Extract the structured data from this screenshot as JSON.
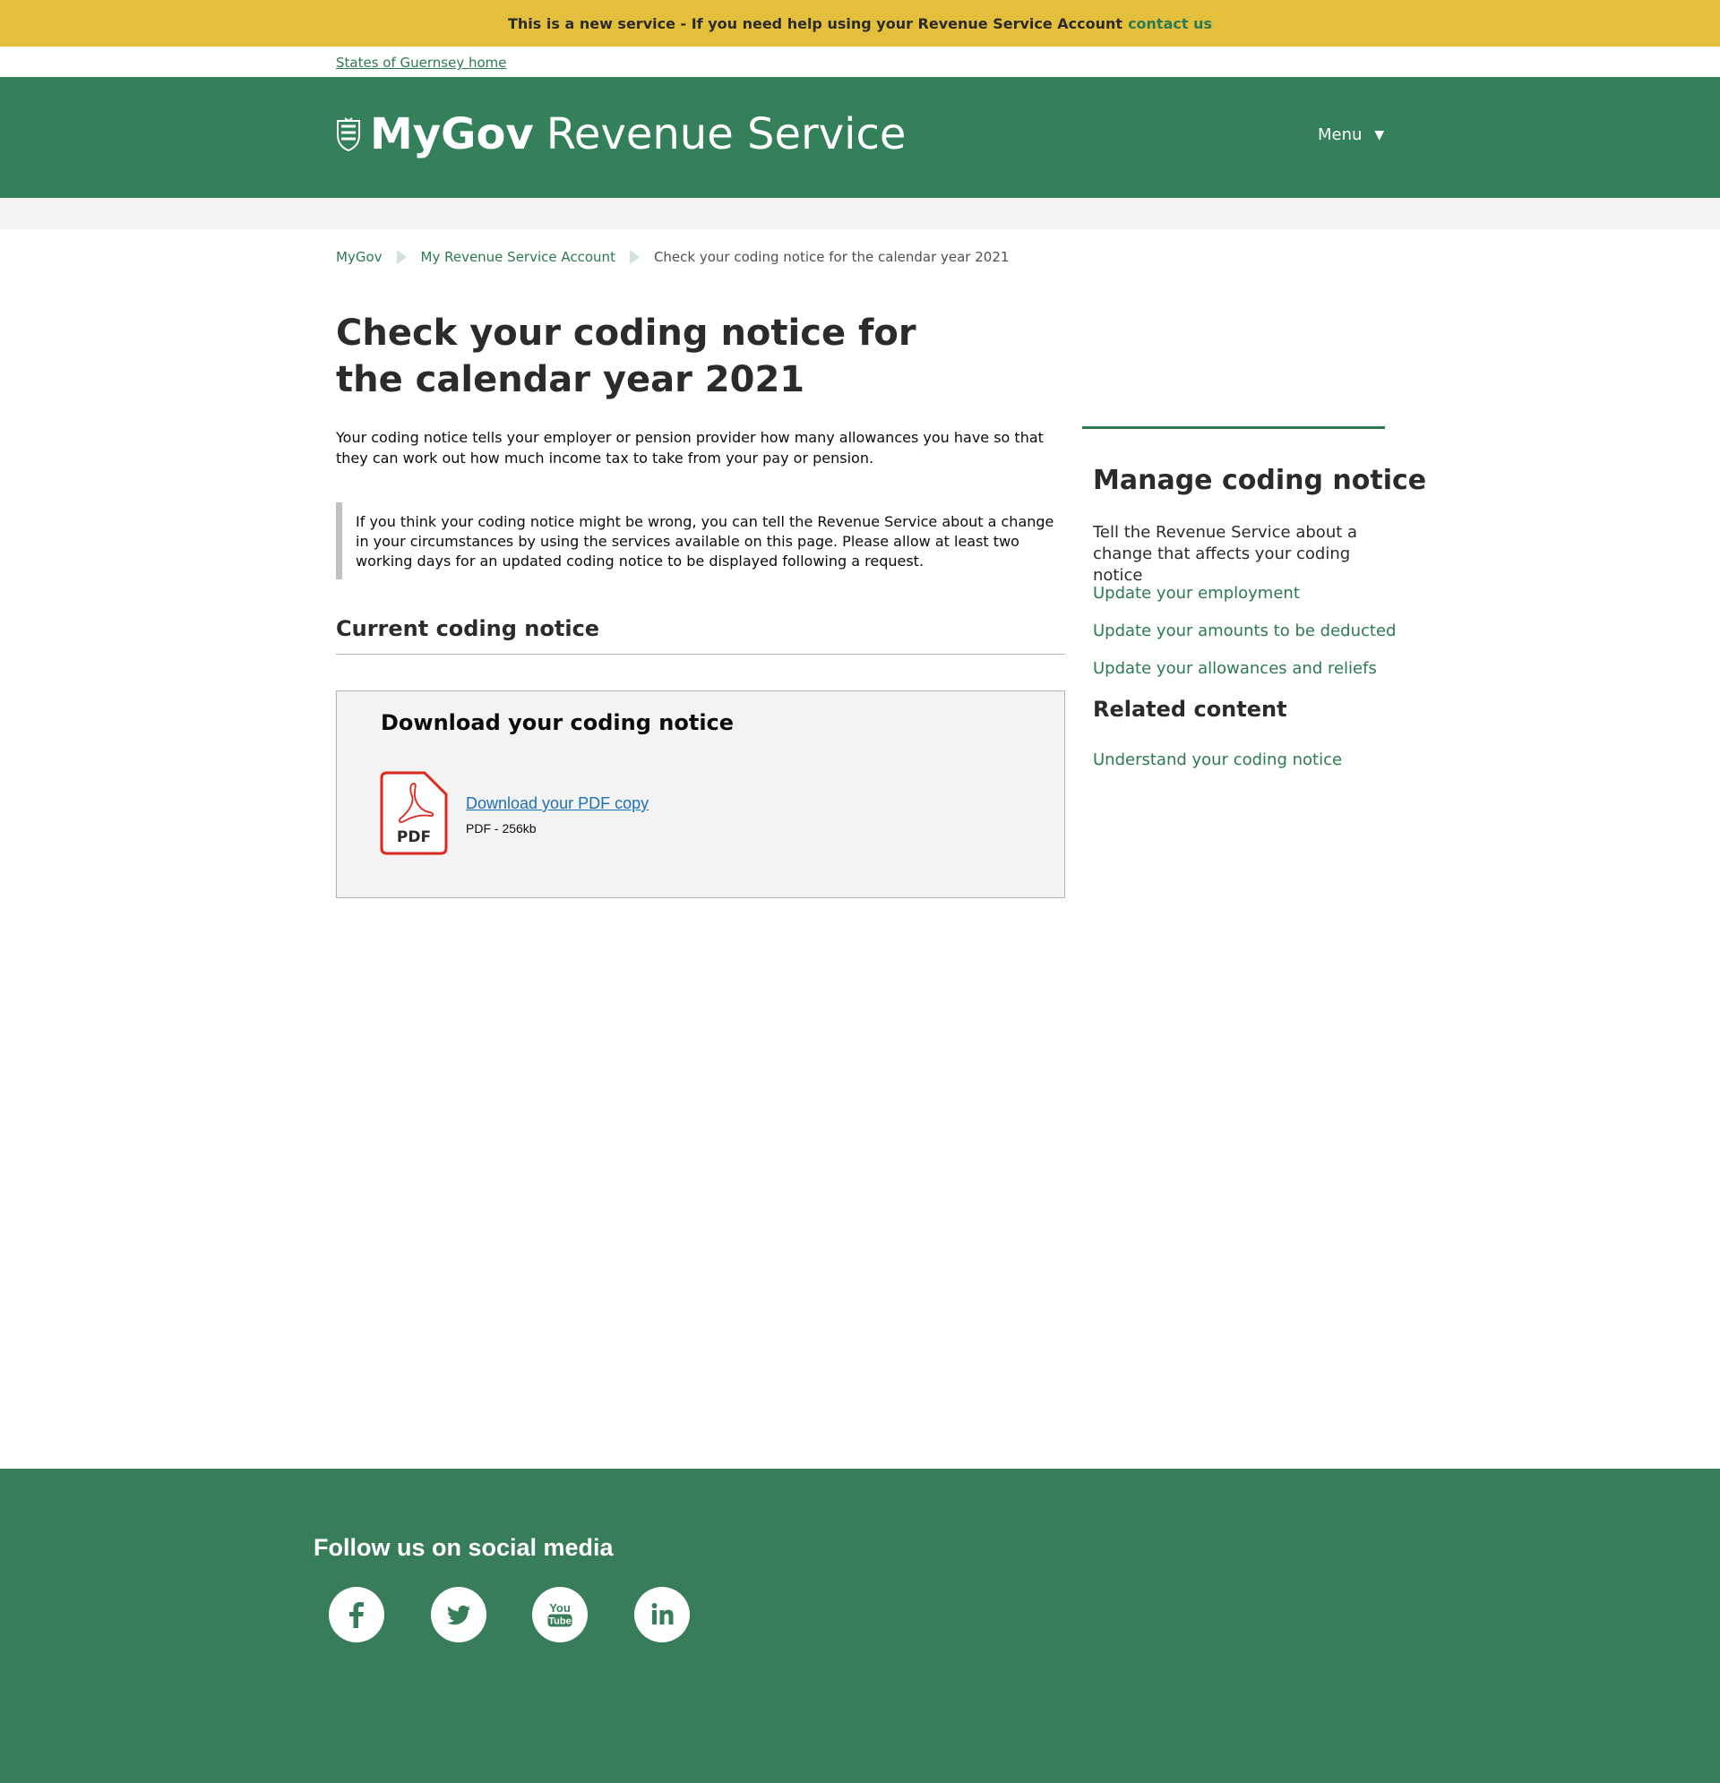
{
  "banner": {
    "text": "This is a new service - If you need help using your Revenue Service Account",
    "link": "contact us"
  },
  "top_link": "States of Guernsey home",
  "header": {
    "brand_bold": "MyGov",
    "brand_light": "Revenue Service",
    "menu_label": "Menu",
    "menu_caret": "▼",
    "crest_icon": "guernsey-crest-icon"
  },
  "breadcrumb": {
    "items": [
      "MyGov",
      "My Revenue Service Account"
    ],
    "current": "Check your coding notice for the calendar year 2021"
  },
  "main": {
    "title": "Check your coding notice for the calendar year 2021",
    "intro": "Your coding notice tells your employer or pension provider how many allowances you have so that they can work out how much income tax to take from your pay or pension.",
    "inset": "If you think your coding notice might be wrong, you can tell the Revenue Service about a change in your circumstances by using the services available on this page. Please allow at least two working days for an updated coding notice to be displayed following a request.",
    "section_title": "Current coding notice",
    "download": {
      "heading": "Download your coding notice",
      "icon_label": "PDF",
      "link": "Download your PDF copy",
      "meta": "PDF - 256kb"
    }
  },
  "sidebar": {
    "heading": "Manage coding notice",
    "description": "Tell the Revenue Service about a change that affects your coding notice",
    "links": [
      "Update your employment",
      "Update your amounts to be deducted",
      "Update your allowances and reliefs"
    ],
    "related_heading": "Related content",
    "related_links": [
      "Understand your coding notice"
    ]
  },
  "footer": {
    "heading": "Follow us on social media",
    "social_icons": [
      "facebook-icon",
      "twitter-icon",
      "youtube-icon",
      "linkedin-icon"
    ],
    "youtube_you": "You",
    "youtube_tube": "Tube"
  },
  "colors": {
    "banner": "#e4bf3c",
    "header": "#33805a",
    "link_green": "#2d7a50",
    "pdf_red": "#e0271b",
    "pdf_link": "#1d70b8",
    "footer": "#387d59"
  }
}
